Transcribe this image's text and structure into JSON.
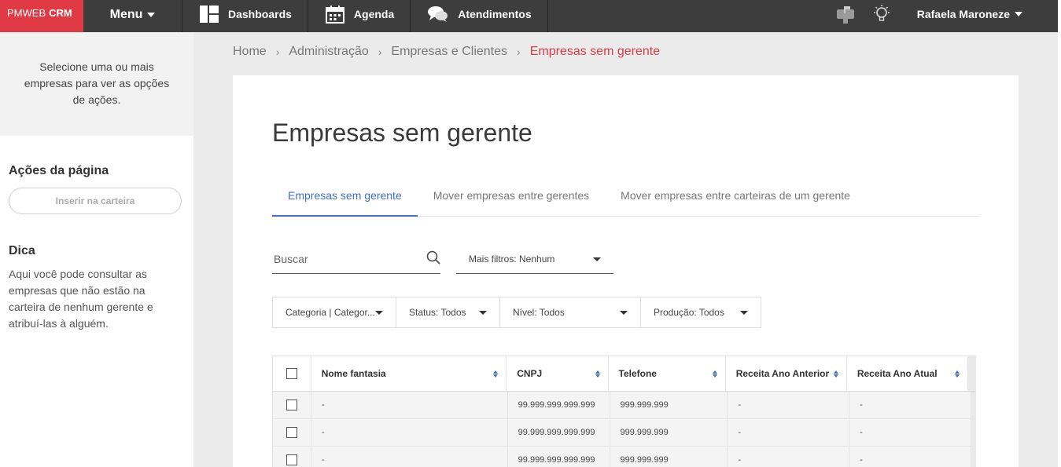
{
  "brand": {
    "name": "PMWEB",
    "suffix": "CRM"
  },
  "topnav": {
    "menu_label": "Menu",
    "items": [
      {
        "label": "Dashboards",
        "icon": "dashboard-icon"
      },
      {
        "label": "Agenda",
        "icon": "calendar-icon"
      },
      {
        "label": "Atendimentos",
        "icon": "chat-icon"
      }
    ],
    "user_name": "Rafaela Maroneze"
  },
  "sidebar": {
    "selection_hint": "Selecione uma ou mais empresas para ver as opções de ações.",
    "actions_title": "Ações da página",
    "insert_button": "Inserir na carteira",
    "tip_title": "Dica",
    "tip_text": "Aqui você pode consultar as empresas que não estão na carteira de nenhum gerente e atribuí-las à alguém."
  },
  "breadcrumb": [
    "Home",
    "Administração",
    "Empresas e Clientes",
    "Empresas sem gerente"
  ],
  "page": {
    "title": "Empresas sem gerente",
    "tabs": [
      "Empresas sem gerente",
      "Mover empresas entre gerentes",
      "Mover empresas entre carteiras de um gerente"
    ],
    "search_placeholder": "Buscar",
    "more_filters": "Mais filtros: Nenhum",
    "filters": [
      "Categoria | Categor...",
      "Status: Todos",
      "Nível: Todos",
      "Produção: Todos"
    ]
  },
  "table": {
    "columns": [
      "Nome fantasia",
      "CNPJ",
      "Telefone",
      "Receita Ano Anterior",
      "Receita Ano Atual"
    ],
    "rows": [
      [
        "-",
        "99.999.999.999.999",
        "999.999.999",
        "-",
        "-"
      ],
      [
        "-",
        "99.999.999.999.999",
        "999.999.999",
        "-",
        "-"
      ],
      [
        "-",
        "99.999.999.999.999",
        "999.999.999",
        "-",
        "-"
      ]
    ]
  },
  "colors": {
    "brand_red": "#e03a45",
    "topbar": "#3d3d3d",
    "accent_blue": "#3f6fc8"
  }
}
